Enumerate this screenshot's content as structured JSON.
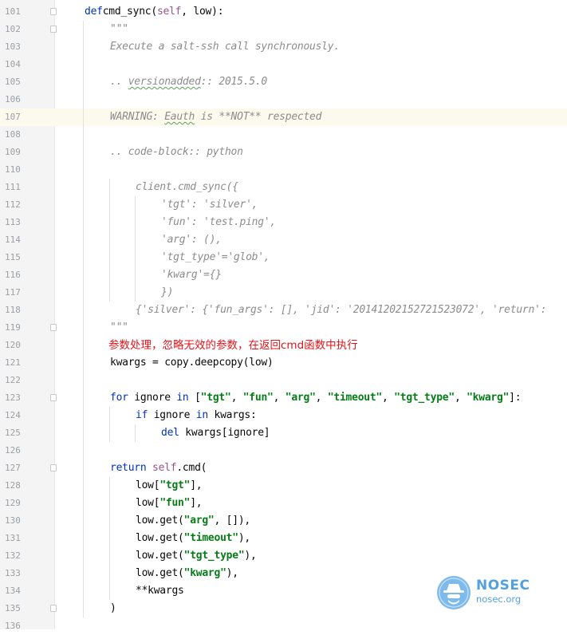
{
  "editor": {
    "lines": [
      {
        "n": "101",
        "segs": [
          [
            "kw",
            "def"
          ],
          [
            "",
            "cmd_sync("
          ],
          [
            "selfc",
            "self"
          ],
          [
            "",
            ", low):"
          ]
        ]
      },
      {
        "n": "102",
        "segs": [
          [
            "cmt",
            "\"\"\""
          ]
        ]
      },
      {
        "n": "103",
        "segs": [
          [
            "cmt",
            "Execute a salt-ssh call synchronously."
          ]
        ]
      },
      {
        "n": "104",
        "segs": []
      },
      {
        "n": "105",
        "segs": [
          [
            "cmt",
            ".. "
          ],
          [
            "cmt-ul",
            "versionadded"
          ],
          [
            "cmt",
            ":: 2015.5.0"
          ]
        ]
      },
      {
        "n": "106",
        "segs": []
      },
      {
        "n": "107",
        "segs": [
          [
            "cmt",
            "WARNING: "
          ],
          [
            "cmt-ul",
            "Eauth"
          ],
          [
            "cmt",
            " is **NOT** respected"
          ]
        ]
      },
      {
        "n": "108",
        "segs": []
      },
      {
        "n": "109",
        "segs": [
          [
            "cmt",
            ".. code-block:: python"
          ]
        ]
      },
      {
        "n": "110",
        "segs": []
      },
      {
        "n": "111",
        "segs": [
          [
            "cmt",
            "client.cmd_sync({"
          ]
        ]
      },
      {
        "n": "112",
        "segs": [
          [
            "cmt",
            "'tgt': 'silver',"
          ]
        ]
      },
      {
        "n": "113",
        "segs": [
          [
            "cmt",
            "'fun': 'test.ping',"
          ]
        ]
      },
      {
        "n": "114",
        "segs": [
          [
            "cmt",
            "'arg': (),"
          ]
        ]
      },
      {
        "n": "115",
        "segs": [
          [
            "cmt",
            "'tgt_type'='glob',"
          ]
        ]
      },
      {
        "n": "116",
        "segs": [
          [
            "cmt",
            "'kwarg'={}"
          ]
        ]
      },
      {
        "n": "117",
        "segs": [
          [
            "cmt",
            "})"
          ]
        ]
      },
      {
        "n": "118",
        "segs": [
          [
            "cmt",
            "{'silver': {'fun_args': [], 'jid': '20141202152721523072', 'return':"
          ]
        ]
      },
      {
        "n": "119",
        "segs": [
          [
            "cmt",
            "\"\"\""
          ]
        ]
      },
      {
        "n": "120",
        "segs": []
      },
      {
        "n": "121",
        "segs": [
          [
            "",
            "kwargs = copy.deepcopy(low)"
          ]
        ]
      },
      {
        "n": "122",
        "segs": []
      },
      {
        "n": "123",
        "segs": [
          [
            "kw",
            "for"
          ],
          [
            "",
            " ignore "
          ],
          [
            "kw",
            "in"
          ],
          [
            "",
            " ["
          ],
          [
            "str",
            "\"tgt\""
          ],
          [
            "",
            ", "
          ],
          [
            "str",
            "\"fun\""
          ],
          [
            "",
            ", "
          ],
          [
            "str",
            "\"arg\""
          ],
          [
            "",
            ", "
          ],
          [
            "str",
            "\"timeout\""
          ],
          [
            "",
            ", "
          ],
          [
            "str",
            "\"tgt_type\""
          ],
          [
            "",
            ", "
          ],
          [
            "str",
            "\"kwarg\""
          ],
          [
            "",
            "]:"
          ]
        ]
      },
      {
        "n": "124",
        "segs": [
          [
            "kw",
            "if"
          ],
          [
            "",
            " ignore "
          ],
          [
            "kw",
            "in"
          ],
          [
            "",
            " kwargs:"
          ]
        ]
      },
      {
        "n": "125",
        "segs": [
          [
            "kw",
            "del"
          ],
          [
            "",
            " kwargs[ignore]"
          ]
        ]
      },
      {
        "n": "126",
        "segs": []
      },
      {
        "n": "127",
        "segs": [
          [
            "kw",
            "return"
          ],
          [
            "",
            " "
          ],
          [
            "selfc",
            "self"
          ],
          [
            "",
            ".cmd("
          ]
        ]
      },
      {
        "n": "128",
        "segs": [
          [
            "",
            "low["
          ],
          [
            "str",
            "\"tgt\""
          ],
          [
            "",
            "],"
          ]
        ]
      },
      {
        "n": "129",
        "segs": [
          [
            "",
            "low["
          ],
          [
            "str",
            "\"fun\""
          ],
          [
            "",
            "],"
          ]
        ]
      },
      {
        "n": "130",
        "segs": [
          [
            "",
            "low.get("
          ],
          [
            "str",
            "\"arg\""
          ],
          [
            "",
            ", []),"
          ]
        ]
      },
      {
        "n": "131",
        "segs": [
          [
            "",
            "low.get("
          ],
          [
            "str",
            "\"timeout\""
          ],
          [
            "",
            "),"
          ]
        ]
      },
      {
        "n": "132",
        "segs": [
          [
            "",
            "low.get("
          ],
          [
            "str",
            "\"tgt_type\""
          ],
          [
            "",
            "),"
          ]
        ]
      },
      {
        "n": "133",
        "segs": [
          [
            "",
            "low.get("
          ],
          [
            "str",
            "\"kwarg\""
          ],
          [
            "",
            "),"
          ]
        ]
      },
      {
        "n": "134",
        "segs": [
          [
            "",
            "**kwargs"
          ]
        ]
      },
      {
        "n": "135",
        "segs": [
          [
            "",
            ")"
          ]
        ]
      },
      {
        "n": "136",
        "segs": []
      }
    ]
  },
  "annotation": {
    "text": "参数处理，忽略无效的参数，在返回cmd函数中执行",
    "color": "#e2141a"
  },
  "watermark": {
    "brand": "NOSEC",
    "domain": "nosec.org",
    "color": "#4a9be0",
    "icon": "spy-hat-icon"
  },
  "colors": {
    "keyword": "#0033b3",
    "comment": "#8c8c8c",
    "string": "#067d17",
    "self": "#94558d",
    "current_line": "#fcfaed"
  }
}
